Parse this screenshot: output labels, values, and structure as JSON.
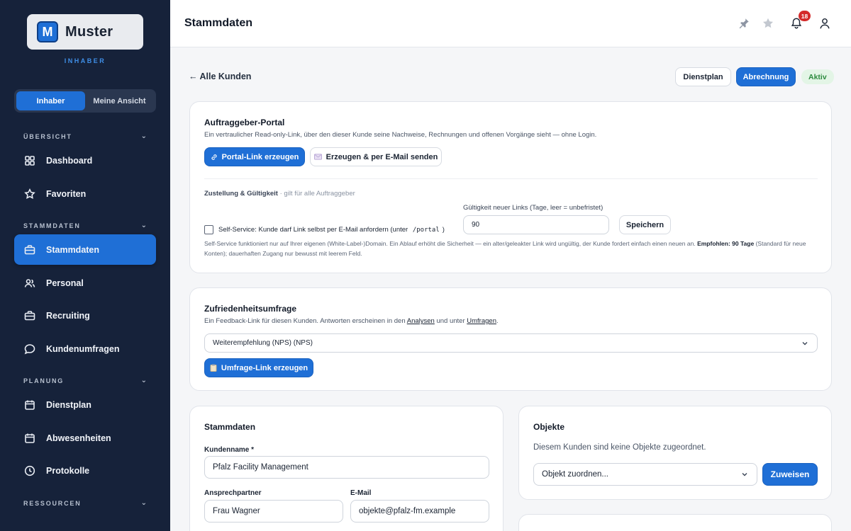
{
  "sidebar": {
    "logo_text": "Muster",
    "logo_letter": "M",
    "role_caption": "INHABER",
    "view_toggle": [
      "Inhaber",
      "Meine Ansicht"
    ],
    "sections": [
      {
        "label": "ÜBERSICHT",
        "items": [
          {
            "label": "Dashboard",
            "icon": "grid-icon"
          },
          {
            "label": "Favoriten",
            "icon": "star-icon"
          }
        ]
      },
      {
        "label": "STAMMDATEN",
        "items": [
          {
            "label": "Stammdaten",
            "icon": "briefcase-icon",
            "active": true
          },
          {
            "label": "Personal",
            "icon": "users-icon"
          },
          {
            "label": "Recruiting",
            "icon": "briefcase-icon"
          },
          {
            "label": "Kundenumfragen",
            "icon": "chat-icon"
          }
        ]
      },
      {
        "label": "PLANUNG",
        "items": [
          {
            "label": "Dienstplan",
            "icon": "calendar-icon"
          },
          {
            "label": "Abwesenheiten",
            "icon": "calendar-icon"
          },
          {
            "label": "Protokolle",
            "icon": "clock-icon"
          }
        ]
      },
      {
        "label": "RESSOURCEN",
        "items": []
      }
    ]
  },
  "header": {
    "title": "Stammdaten",
    "notification_count": "18"
  },
  "toolbar": {
    "back_label": "← Alle Kunden",
    "dienstplan_label": "Dienstplan",
    "abrechnung_label": "Abrechnung",
    "status": "Aktiv"
  },
  "portal": {
    "title": "Auftraggeber-Portal",
    "description": "Ein vertraulicher Read-only-Link, über den dieser Kunde seine Nachweise, Rechnungen und offenen Vorgänge sieht — ohne Login.",
    "create_link_label": "Portal-Link erzeugen",
    "send_mail_label": "Erzeugen & per E-Mail senden",
    "delivery_heading": "Zustellung & Gültigkeit",
    "delivery_note": " · gilt für alle Auftraggeber",
    "validity_label": "Gültigkeit neuer Links (Tage, leer = unbefristet)",
    "validity_value": "90",
    "save_label": "Speichern",
    "self_service_prefix": "Self-Service: Kunde darf Link selbst per E-Mail anfordern (unter",
    "self_service_path": "/portal",
    "self_service_suffix": ")",
    "help_text": "Self-Service funktioniert nur auf Ihrer eigenen (White-Label-)Domain. Ein Ablauf erhöht die Sicherheit — ein alter/geleakter Link wird ungültig, der Kunde fordert einfach einen neuen an.",
    "help_bold": "Empfohlen: 90 Tage",
    "help_text_2": "(Standard für neue Konten); dauerhaften Zugang nur bewusst mit leerem Feld."
  },
  "survey": {
    "title": "Zufriedenheitsumfrage",
    "desc_prefix": "Ein Feedback-Link für diesen Kunden. Antworten erscheinen in den",
    "link_analysen": "Analysen",
    "desc_mid": "und unter",
    "link_umfragen": "Umfragen",
    "desc_suffix": ".",
    "selected": "Weiterempfehlung (NPS) (NPS)",
    "create_label": "Umfrage-Link erzeugen"
  },
  "master": {
    "title": "Stammdaten",
    "customer_name_label": "Kundenname *",
    "customer_name": "Pfalz Facility Management",
    "contact_label": "Ansprechpartner",
    "contact": "Frau Wagner",
    "email_label": "E-Mail",
    "email": "objekte@pfalz-fm.example"
  },
  "objects": {
    "title": "Objekte",
    "empty_text": "Diesem Kunden sind keine Objekte zugeordnet.",
    "select_placeholder": "Objekt zuordnen...",
    "assign_label": "Zuweisen"
  },
  "colors": {
    "sidebar_bg": "#16223a",
    "primary": "#1f6fd6",
    "status_green": "#2c8a3e",
    "badge_red": "#d42a2a"
  }
}
